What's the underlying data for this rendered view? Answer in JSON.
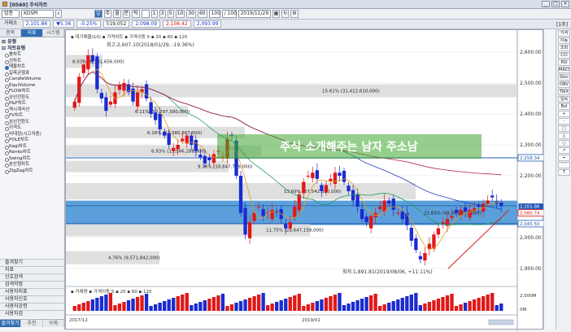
{
  "window": {
    "title": "[0560] 주식차트",
    "min": "_",
    "max": "□",
    "close": "×"
  },
  "toolbar": {
    "market": "업종",
    "code": "KOSPI",
    "periods": [
      "일",
      "주",
      "월",
      "분",
      "틱"
    ],
    "intervals": [
      "1",
      "3",
      "5",
      "10",
      "30",
      "60"
    ],
    "count": "100",
    "total": "/ 100",
    "date": "2019/11/29",
    "icons": [
      "calendar-icon",
      "refresh-icon",
      "settings-icon"
    ]
  },
  "quote": {
    "label": "거래소",
    "price": "2,101.86",
    "change": "▼5.36",
    "pct": "-0.25%",
    "volume": "519,052",
    "open": "2,098.09",
    "high": "2,106.42",
    "low": "2,093.99",
    "right_label": "[1주]"
  },
  "sidebar": {
    "tabs": [
      "종목",
      "지표",
      "시스템"
    ],
    "active_tab": 1,
    "group1": "⊞ 유형",
    "group2": "⊟ 차트유형",
    "items": [
      "봉차트",
      "선차트",
      "매물차트",
      "일목균형표",
      "CandleVolume",
      "EquiVolume",
      "FLOW차트",
      "상선전환도",
      "P&F차트",
      "역시계곡선",
      "PV차트",
      "삼선전환도",
      "이격도",
      "비대칭(시고저종)",
      "POLE차트",
      "Kagi차트",
      "Renko차트",
      "Swing차트",
      "분산형차트",
      "ZigZag차트"
    ],
    "selected_index": 2,
    "bottom": [
      "즐겨찾기",
      "지표",
      "신호검색",
      "검색약정",
      "사용자지표",
      "사용자신호",
      "사용자강령",
      "사용자검"
    ],
    "bottom_tabs": [
      "즐겨찾기",
      "추천",
      "삭제"
    ]
  },
  "chart": {
    "legend": "▪ 대기매물(10) ▪ 가격차트 ▪ 가격이동 5 ▪ 20 ▪ 60 ▪ 120",
    "max_annotation": "최고:2,607.10(2018/01/29, -19.36%)",
    "min_annotation": "최저:1,891.81(2019/08/06, +11.11%)",
    "watermark": "주식 소개해주는 남자 주소남",
    "volume_legend": "▪ 거래량 ▪ 가격이동 5 ▪ 20 ▪ 60 ▪ 120",
    "volume_axis": [
      "2,500M",
      "0M"
    ],
    "date_labels": [
      "2017/12",
      "2019/01"
    ],
    "y_ticks": [
      "2,600.00",
      "2,500.00",
      "2,400.00",
      "2,300.00",
      "2,200.00",
      "2,100.00",
      "2,000.00",
      "1,900.00"
    ],
    "price_tags": [
      {
        "text": "2,258.34",
        "color": "#2159b5"
      },
      {
        "text": "2,101.86",
        "color": "#ffffff"
      },
      {
        "text": "2,080.74",
        "color": "#d81414"
      },
      {
        "text": "2,045.50",
        "color": "#2159b5"
      }
    ],
    "volume_profile": [
      {
        "text": "8.03% (6,381,656,000)"
      },
      {
        "text": "15.61% (31,412,610,000)"
      },
      {
        "text": "6.11% (12,297,580,000)"
      },
      {
        "text": "6.16% (12,380,567,000)"
      },
      {
        "text": "6.93% (13,946,288,000)"
      },
      {
        "text": "9.36% (18,847,739,000)"
      },
      {
        "text": "13.69% (27,542,380,000)"
      },
      {
        "text": "22.83% (45,945,219,000)"
      },
      {
        "text": "11.75% (23,647,158,000)"
      },
      {
        "text": "4.76% (9,571,842,000)"
      }
    ],
    "price_range": [
      1850,
      2650
    ]
  },
  "right_toolbar": [
    "가격",
    "이동",
    "조회",
    "CCI",
    "RSI",
    "MACD",
    "Stoc",
    "OBV",
    "TRIX",
    "일목",
    "Bol",
    "+",
    "-",
    "□",
    "△",
    "○",
    "↗",
    "━",
    "⌒",
    "T"
  ]
}
